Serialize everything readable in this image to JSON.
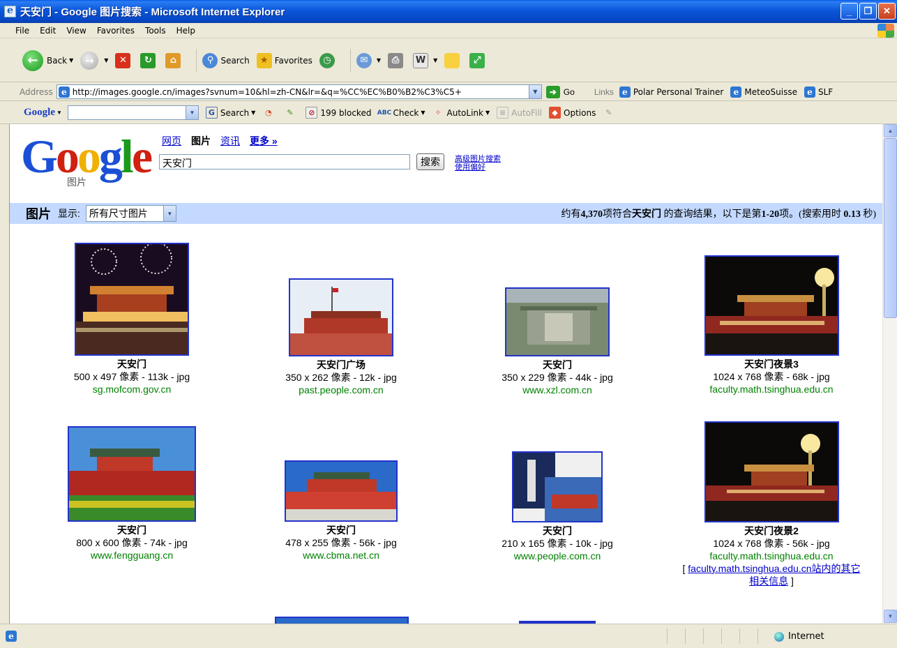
{
  "window": {
    "title": "天安门 - Google 图片搜索 - Microsoft Internet Explorer",
    "min_label": "_",
    "max_label": "❐",
    "close_label": "✕"
  },
  "menu": [
    "File",
    "Edit",
    "View",
    "Favorites",
    "Tools",
    "Help"
  ],
  "toolbar": {
    "back": "Back",
    "search": "Search",
    "favorites": "Favorites"
  },
  "address": {
    "label": "Address",
    "url": "http://images.google.cn/images?svnum=10&hl=zh-CN&lr=&q=%CC%EC%B0%B2%C3%C5+",
    "go": "Go",
    "links_label": "Links",
    "links": [
      "Polar Personal Trainer",
      "MeteoSuisse",
      "SLF"
    ]
  },
  "google_toolbar": {
    "logo": "Google",
    "search": "Search",
    "blocked": "199 blocked",
    "check": "Check",
    "autolink": "AutoLink",
    "autofill": "AutoFill",
    "options": "Options"
  },
  "page": {
    "logo_sub": "图片",
    "nav": [
      "网页",
      "图片",
      "资讯",
      "更多 »"
    ],
    "query": "天安门",
    "search_button": "搜索",
    "adv_link": "高级图片搜索",
    "pref_link": "使用偏好",
    "result_title": "图片",
    "show_label": "显示:",
    "size_option": "所有尺寸图片",
    "stats": {
      "prefix": "约有",
      "count": "4,370",
      "mid": "项符合",
      "query": "天安门",
      "mid2": " 的查询结果，以下是第",
      "range": "1-20",
      "mid3": "项。(搜索用时 ",
      "time": "0.13",
      "suffix": " 秒)"
    }
  },
  "results": [
    {
      "title": "天安门",
      "size": "500 x 497 像素 - 113k - jpg",
      "site": "sg.mofcom.gov.cn"
    },
    {
      "title": "天安门广场",
      "size": "350 x 262 像素 - 12k - jpg",
      "site": "past.people.com.cn"
    },
    {
      "title": "天安门",
      "size": "350 x 229 像素 - 44k - jpg",
      "site": "www.xzl.com.cn"
    },
    {
      "title": "天安门夜景3",
      "size": "1024 x 768 像素 - 68k - jpg",
      "site": "faculty.math.tsinghua.edu.cn"
    },
    {
      "title": "天安门",
      "size": "800 x 600 像素 - 74k - jpg",
      "site": "www.fengguang.cn"
    },
    {
      "title": "天安门",
      "size": "478 x 255 像素 - 56k - jpg",
      "site": "www.cbma.net.cn"
    },
    {
      "title": "天安门",
      "size": "210 x 165 像素 - 10k - jpg",
      "site": "www.people.com.cn"
    },
    {
      "title": "天安门夜景2",
      "size": "1024 x 768 像素 - 56k - jpg",
      "site": "faculty.math.tsinghua.edu.cn",
      "more_link_a": "faculty.math.tsinghua.edu.cn站内的其它",
      "more_link_b": "相关信息"
    }
  ],
  "status": {
    "zone": "Internet"
  }
}
